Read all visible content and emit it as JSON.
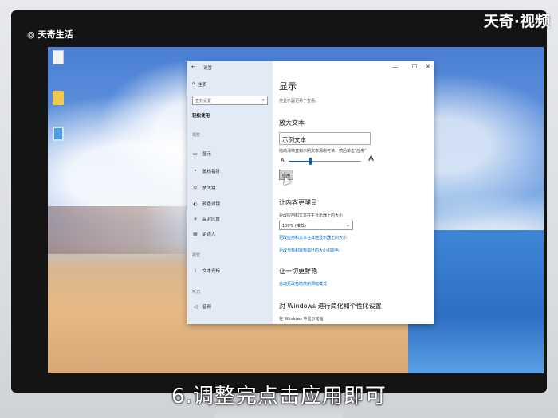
{
  "watermark": {
    "left": "天奇生活",
    "right": "天奇·视频"
  },
  "caption": "6.调整完点击应用即可",
  "window": {
    "title": "设置",
    "controls": {
      "minimize": "—",
      "maximize": "☐",
      "close": "✕"
    },
    "nav": {
      "home": "主页",
      "search_placeholder": "查找设置",
      "current": "轻松使用",
      "section_view": "视觉",
      "items_view": [
        "显示",
        "鼠标指针",
        "文本光标",
        "放大镜",
        "颜色滤镜",
        "高对比度",
        "讲述人"
      ],
      "section_hear": "听力",
      "items_hear": [
        "音频"
      ]
    },
    "content": {
      "title": "显示",
      "subtitle": "使显示器更易于查看。",
      "enlarge_text_heading": "放大文本",
      "sample_text": "示例文本",
      "slider_hint": "拖动滑块直到示例文本清晰可读，然后单击\"应用\"",
      "slider_small": "A",
      "slider_large": "A",
      "slider_value": 0.3,
      "apply_label": "应用",
      "bigger_heading": "让内容更醒目",
      "scale_label": "更改应用和文本在主显示器上的大小",
      "scale_value": "100% (推荐)",
      "link1": "更改应用和文本在其他显示器上的大小",
      "link2": "更改光标和鼠标指针的大小和颜色",
      "simplify_heading": "让一切更鲜艳",
      "link3": "自动更改亮暗使用调暗模式",
      "personalize_heading": "对 Windows 进行简化和个性化设置",
      "personalize_sub": "在 Windows 中显示动画"
    }
  }
}
